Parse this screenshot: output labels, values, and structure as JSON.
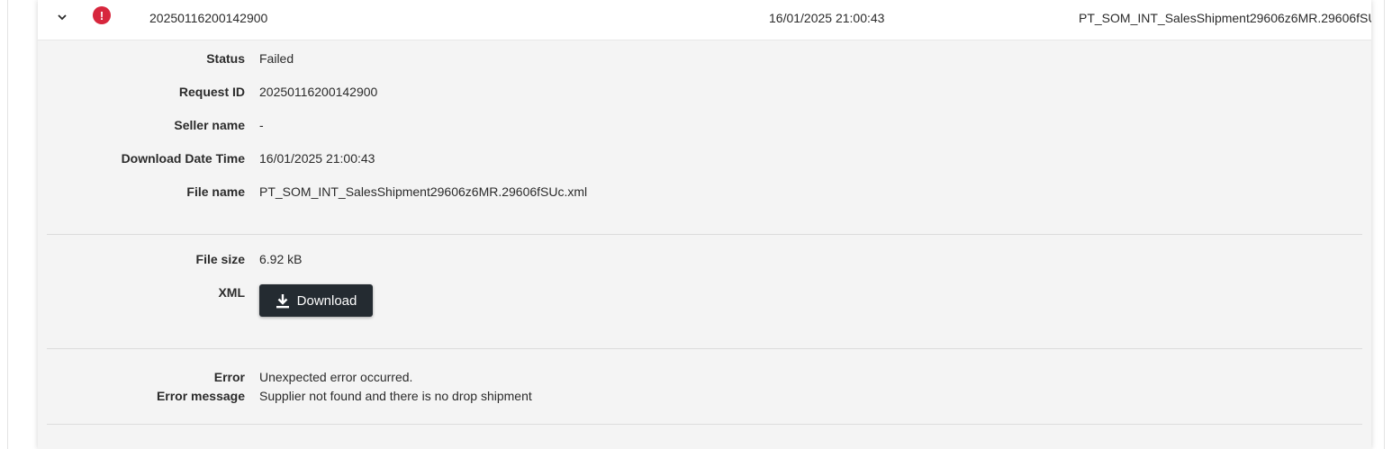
{
  "row": {
    "request_id": "20250116200142900",
    "download_datetime": "16/01/2025 21:00:43",
    "file_name_truncated": "PT_SOM_INT_SalesShipment29606z6MR.29606fSU",
    "status_icon_glyph": "!",
    "status_icon_name": "error-icon",
    "expand_icon_name": "chevron-down-icon"
  },
  "details": {
    "status": {
      "label": "Status",
      "value": "Failed"
    },
    "request_id": {
      "label": "Request ID",
      "value": "20250116200142900"
    },
    "seller_name": {
      "label": "Seller name",
      "value": "-"
    },
    "download_datetime": {
      "label": "Download Date Time",
      "value": "16/01/2025 21:00:43"
    },
    "file_name": {
      "label": "File name",
      "value": "PT_SOM_INT_SalesShipment29606z6MR.29606fSUc.xml"
    },
    "file_size": {
      "label": "File size",
      "value": "6.92 kB"
    },
    "xml": {
      "label": "XML",
      "button_label": "Download",
      "button_icon": "download-icon"
    },
    "error": {
      "label": "Error",
      "value": "Unexpected error occurred."
    },
    "error_message": {
      "label": "Error message",
      "value": "Supplier not found and there is no drop shipment"
    }
  },
  "colors": {
    "error_red": "#d7263d",
    "button_dark": "#242b31",
    "details_bg": "#f4f4f4"
  }
}
